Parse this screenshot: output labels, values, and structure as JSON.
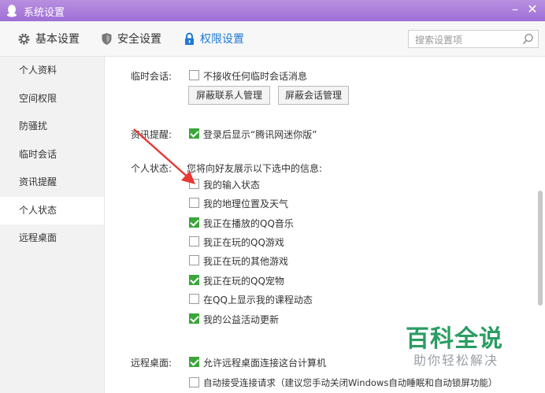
{
  "window": {
    "title": "系统设置",
    "minimize": "–",
    "close": "✕"
  },
  "tabs": [
    {
      "label": "基本设置",
      "icon": "gear-icon"
    },
    {
      "label": "安全设置",
      "icon": "shield-icon"
    },
    {
      "label": "权限设置",
      "icon": "lock-icon",
      "active": true
    }
  ],
  "search": {
    "placeholder": "搜索设置项"
  },
  "sidebar": {
    "items": [
      {
        "label": "个人资料"
      },
      {
        "label": "空间权限"
      },
      {
        "label": "防骚扰"
      },
      {
        "label": "临时会话"
      },
      {
        "label": "资讯提醒"
      },
      {
        "label": "个人状态",
        "active": true
      },
      {
        "label": "远程桌面"
      }
    ]
  },
  "temp_session": {
    "label": "临时会话:",
    "option": {
      "label": "不接收任何临时会话消息",
      "checked": false
    },
    "buttons": [
      "屏蔽联系人管理",
      "屏蔽会话管理"
    ]
  },
  "news": {
    "label": "资讯提醒:",
    "option": {
      "label": "登录后显示“腾讯网迷你版”",
      "checked": true
    }
  },
  "status": {
    "label": "个人状态:",
    "description": "您将向好友展示以下选中的信息:",
    "options": [
      {
        "label": "我的输入状态",
        "checked": false
      },
      {
        "label": "我的地理位置及天气",
        "checked": false
      },
      {
        "label": "我正在播放的QQ音乐",
        "checked": true
      },
      {
        "label": "我正在玩的QQ游戏",
        "checked": false
      },
      {
        "label": "我正在玩的其他游戏",
        "checked": false
      },
      {
        "label": "我正在玩的QQ宠物",
        "checked": true
      },
      {
        "label": "在QQ上显示我的课程动态",
        "checked": false
      },
      {
        "label": "我的公益活动更新",
        "checked": true
      }
    ]
  },
  "remote": {
    "label": "远程桌面:",
    "options": [
      {
        "label": "允许远程桌面连接这台计算机",
        "checked": true
      },
      {
        "label": "自动接受连接请求（建议您手动关闭Windows自动睡眠和自动锁屏功能）",
        "checked": false
      }
    ]
  },
  "watermark": {
    "title": "百科全说",
    "subtitle": "助你轻松解决"
  },
  "colors": {
    "title_bar": "#a97ddb",
    "accent": "#1e7ad4",
    "check": "#3aa63a",
    "arrow": "#e53935",
    "watermark": "#2a9d63"
  }
}
